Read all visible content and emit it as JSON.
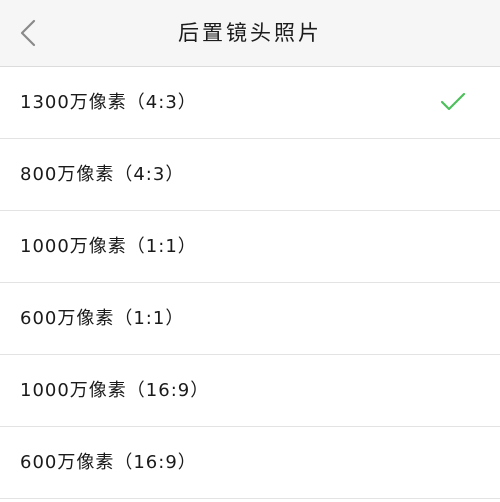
{
  "header": {
    "title": "后置镜头照片",
    "back_icon": "chevron-left-icon"
  },
  "options": [
    {
      "label": "1300万像素（4:3）",
      "selected": true
    },
    {
      "label": "800万像素（4:3）",
      "selected": false
    },
    {
      "label": "1000万像素（1:1）",
      "selected": false
    },
    {
      "label": "600万像素（1:1）",
      "selected": false
    },
    {
      "label": "1000万像素（16:9）",
      "selected": false
    },
    {
      "label": "600万像素（16:9）",
      "selected": false
    }
  ],
  "check_icon": "check-icon",
  "colors": {
    "accent": "#4cc05a",
    "header_bg": "#f6f6f6",
    "divider": "#e3e3e3",
    "back_icon": "#8a8a8a"
  }
}
